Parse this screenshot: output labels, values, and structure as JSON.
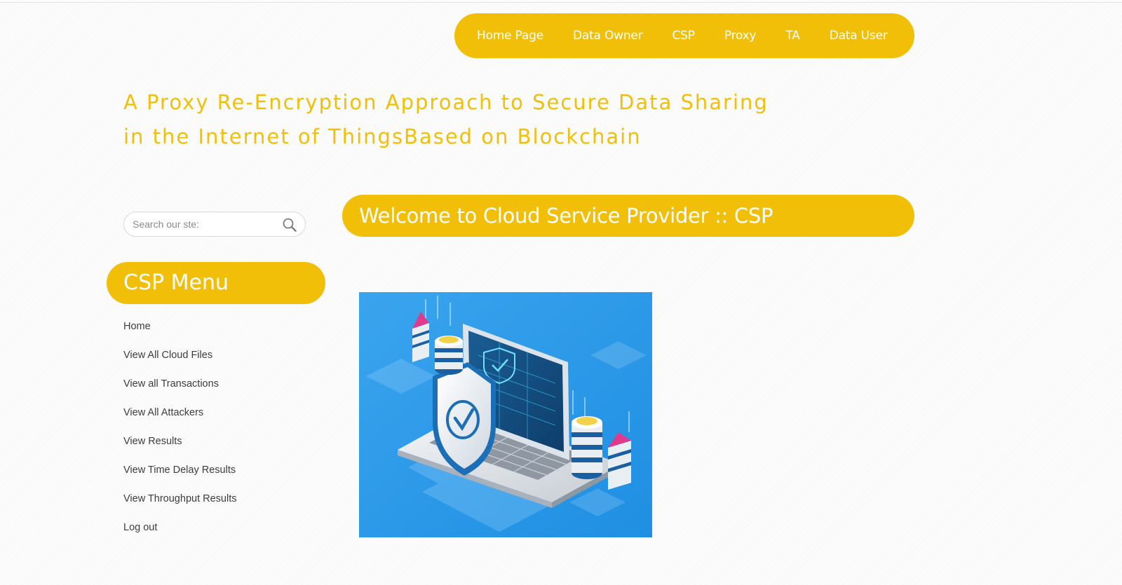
{
  "nav": {
    "items": [
      "Home Page",
      "Data Owner",
      "CSP",
      "Proxy",
      "TA",
      "Data User"
    ]
  },
  "site": {
    "title_line1": "A Proxy Re-Encryption Approach to Secure Data Sharing",
    "title_line2": "in the Internet of ThingsBased on Blockchain"
  },
  "search": {
    "placeholder": "Search our ste:",
    "icon": "search-icon"
  },
  "sidebar": {
    "heading": "CSP Menu",
    "items": [
      "Home",
      "View All Cloud Files",
      "View all Transactions",
      "View All Attackers",
      "View Results",
      "View Time Delay Results",
      "View Throughput Results",
      "Log out"
    ]
  },
  "main": {
    "welcome": "Welcome to Cloud Service Provider :: CSP"
  },
  "colors": {
    "accent": "#f2bf08",
    "menu_text": "#3d3d3d",
    "hero_bg": "#2b9ae8"
  }
}
